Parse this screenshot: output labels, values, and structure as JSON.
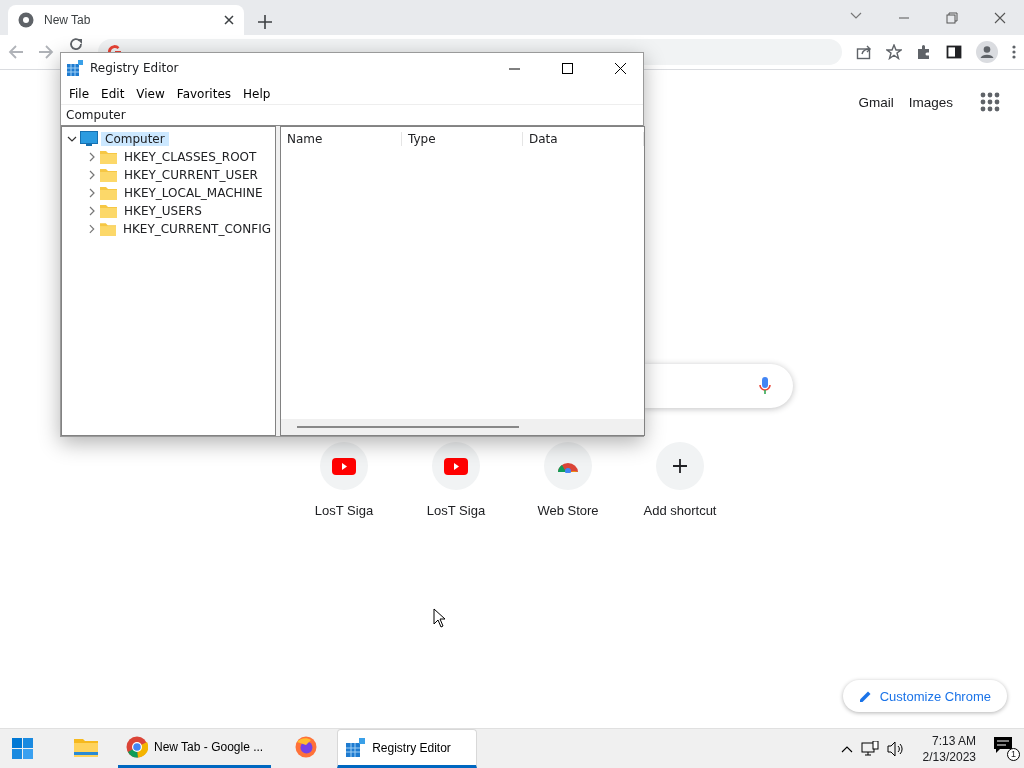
{
  "browser": {
    "tab": {
      "title": "New Tab",
      "selected": true
    }
  },
  "ntp": {
    "links": [
      "Gmail",
      "Images"
    ],
    "shortcuts": [
      {
        "label": "LosT Siga",
        "kind": "youtube"
      },
      {
        "label": "LosT Siga",
        "kind": "youtube"
      },
      {
        "label": "Web Store",
        "kind": "store"
      },
      {
        "label": "Add shortcut",
        "kind": "add"
      }
    ],
    "customize": "Customize Chrome"
  },
  "regedit": {
    "title": "Registry Editor",
    "menu": [
      "File",
      "Edit",
      "View",
      "Favorites",
      "Help"
    ],
    "path": "Computer",
    "tree": [
      {
        "label": "Computer",
        "expanded": true,
        "selected": true,
        "children": [
          {
            "label": "HKEY_CLASSES_ROOT",
            "expanded": false,
            "selected": false
          },
          {
            "label": "HKEY_CURRENT_USER",
            "expanded": false,
            "selected": false
          },
          {
            "label": "HKEY_LOCAL_MACHINE",
            "expanded": false,
            "selected": false
          },
          {
            "label": "HKEY_USERS",
            "expanded": false,
            "selected": false
          },
          {
            "label": "HKEY_CURRENT_CONFIG",
            "expanded": false,
            "selected": false
          }
        ]
      }
    ],
    "columns": [
      "Name",
      "Type",
      "Data"
    ]
  },
  "taskbar": {
    "apps": [
      {
        "kind": "explorer",
        "running": false,
        "selected": false
      },
      {
        "kind": "chrome",
        "label": "New Tab - Google ...",
        "running": true,
        "selected": false
      },
      {
        "kind": "firefox",
        "running": false,
        "selected": false
      },
      {
        "kind": "regedit",
        "label": "Registry Editor",
        "running": true,
        "selected": true
      }
    ],
    "time": "7:13 AM",
    "date": "2/13/2023",
    "notifications": "1"
  }
}
